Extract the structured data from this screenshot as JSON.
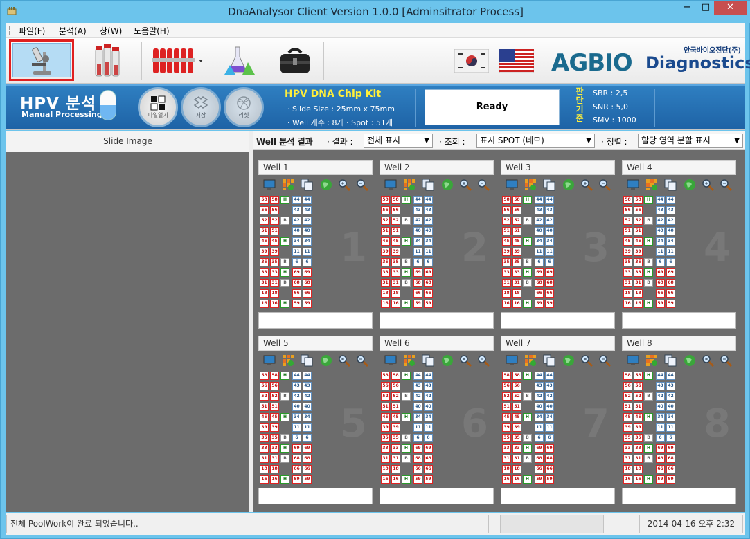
{
  "window": {
    "title": "DnaAnalysor Client Version 1.0.0 [Adminsitrator Process]",
    "min": "−",
    "max": "□",
    "close": "✕"
  },
  "menu": [
    "파일(F)",
    "분석(A)",
    "창(W)",
    "도움말(H)"
  ],
  "toolbar": {
    "items": [
      "microscope-icon",
      "test-tubes-icon",
      "sample-rack-icon",
      "flasks-icon",
      "doctor-bag-icon",
      "korea-flag-icon",
      "usa-flag-icon"
    ],
    "logo_main": "AGBIO",
    "logo_sub": "Diagnostics",
    "logo_kr": "안국바이오진단(주)",
    "colors": {
      "logo_blue": "#1a4a8e",
      "logo_green": "#58b42a"
    }
  },
  "hpv": {
    "title": "HPV 분석",
    "subtitle": "Manual Processing",
    "buttons": [
      "파일열기",
      "저장",
      "리셋"
    ],
    "kit_title": "HPV DNA Chip Kit",
    "kit_size": "· Slide Size : 25mm x 75mm",
    "kit_well": "· Well 개수 : 8개  · Spot : 51개",
    "status": "Ready",
    "criteria_label": "판단기준",
    "sbr": "SBR : 2,5",
    "snr": "SNR : 5,0",
    "smv": "SMV : 1000"
  },
  "left": {
    "header": "Slide Image"
  },
  "right": {
    "header": "Well 분석 결과",
    "result_label": "· 결과 :",
    "result_value": "전체 표시",
    "view_label": "· 조회 :",
    "view_value": "표시 SPOT (네모)",
    "sort_label": "· 정렬 :",
    "sort_value": "할당 영역 분할 표시"
  },
  "wells": [
    {
      "title": "Well 1",
      "num": "1"
    },
    {
      "title": "Well 2",
      "num": "2"
    },
    {
      "title": "Well 3",
      "num": "3"
    },
    {
      "title": "Well 4",
      "num": "4"
    },
    {
      "title": "Well 5",
      "num": "5"
    },
    {
      "title": "Well 6",
      "num": "6"
    },
    {
      "title": "Well 7",
      "num": "7"
    },
    {
      "title": "Well 8",
      "num": "8"
    }
  ],
  "well_icons": [
    "monitor-icon",
    "grid-icon",
    "copy-icon",
    "globe-icon",
    "zoom-in-icon",
    "zoom-out-icon"
  ],
  "spot_grid": [
    [
      [
        "58",
        "r"
      ],
      [
        "58",
        "r"
      ],
      [
        "H",
        "h"
      ],
      [
        "44",
        "b"
      ],
      [
        "44",
        "b"
      ]
    ],
    [
      [
        "56",
        "r"
      ],
      [
        "56",
        "r"
      ],
      [
        "",
        ""
      ],
      [
        "43",
        "b"
      ],
      [
        "43",
        "b"
      ]
    ],
    [
      [
        "52",
        "r"
      ],
      [
        "52",
        "r"
      ],
      [
        "B",
        "g"
      ],
      [
        "42",
        "b"
      ],
      [
        "42",
        "b"
      ]
    ],
    [
      [
        "51",
        "r"
      ],
      [
        "51",
        "r"
      ],
      [
        "",
        ""
      ],
      [
        "40",
        "b"
      ],
      [
        "40",
        "b"
      ]
    ],
    [
      [
        "45",
        "r"
      ],
      [
        "45",
        "r"
      ],
      [
        "H",
        "h"
      ],
      [
        "34",
        "b"
      ],
      [
        "34",
        "b"
      ]
    ],
    [
      [
        "39",
        "r"
      ],
      [
        "39",
        "r"
      ],
      [
        "",
        ""
      ],
      [
        "11",
        "b"
      ],
      [
        "11",
        "b"
      ]
    ],
    [
      [
        "35",
        "r"
      ],
      [
        "35",
        "r"
      ],
      [
        "B",
        "g"
      ],
      [
        "6",
        "b"
      ],
      [
        "6",
        "b"
      ]
    ],
    [
      [
        "33",
        "r"
      ],
      [
        "33",
        "r"
      ],
      [
        "H",
        "h"
      ],
      [
        "69",
        "r"
      ],
      [
        "69",
        "r"
      ]
    ],
    [
      [
        "31",
        "r"
      ],
      [
        "31",
        "r"
      ],
      [
        "B",
        "g"
      ],
      [
        "68",
        "r"
      ],
      [
        "68",
        "r"
      ]
    ],
    [
      [
        "18",
        "r"
      ],
      [
        "18",
        "r"
      ],
      [
        "",
        ""
      ],
      [
        "66",
        "r"
      ],
      [
        "66",
        "r"
      ]
    ],
    [
      [
        "16",
        "r"
      ],
      [
        "16",
        "r"
      ],
      [
        "H",
        "h"
      ],
      [
        "59",
        "r"
      ],
      [
        "59",
        "r"
      ]
    ]
  ],
  "status": {
    "message": "전체 PoolWork이 완료 되었습니다..",
    "datetime": "2014-04-16 오후 2:32"
  }
}
